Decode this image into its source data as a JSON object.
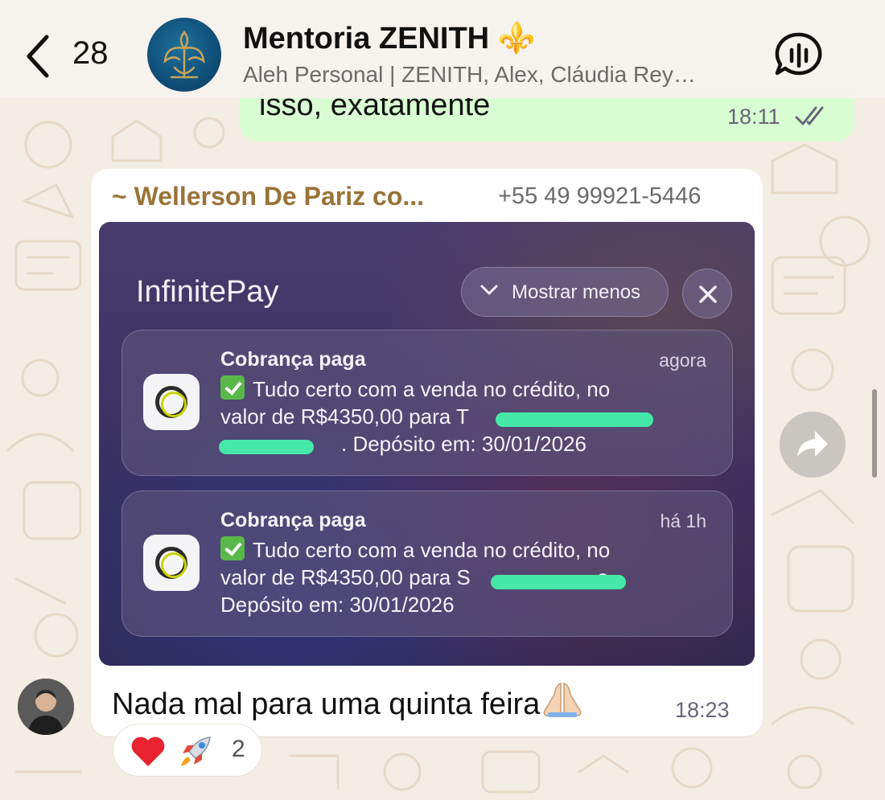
{
  "header": {
    "back_count": "28",
    "title": "Mentoria ZENITH ⚜️",
    "subtitle": "Aleh Personal | ZENITH, Alex, Cláudia Rey…"
  },
  "outgoing_message": {
    "text": "isso, exatamente",
    "time": "18:11",
    "status": "read"
  },
  "incoming_message": {
    "sender_name": "~ Wellerson De Pariz co...",
    "sender_phone": "+55 49 99921-5446",
    "image": {
      "app_name": "InfinitePay",
      "show_less_label": "Mostrar menos",
      "notifications": [
        {
          "title": "Cobrança paga",
          "time": "agora",
          "line1": "Tudo certo com a venda no crédito, no",
          "line2": "valor de R$4350,00 para T",
          "line3": ". Depósito em: 30/01/2026"
        },
        {
          "title": "Cobrança paga",
          "time": "há 1h",
          "line1": "Tudo certo com a venda no crédito, no",
          "line2": "valor de R$4350,00 para S",
          "line2_end": "s.",
          "line3": "Depósito em: 30/01/2026"
        }
      ]
    },
    "caption": "Nada mal para uma quinta feira",
    "caption_emoji": "pray-icon",
    "time": "18:23",
    "reactions": {
      "emojis": [
        "heart",
        "rocket"
      ],
      "count": "2"
    }
  },
  "colors": {
    "wallpaper": "#f3ede4",
    "outgoing_bubble": "#d9fdd3",
    "sender_name": "#9a7338",
    "redaction": "#45e8a8"
  }
}
